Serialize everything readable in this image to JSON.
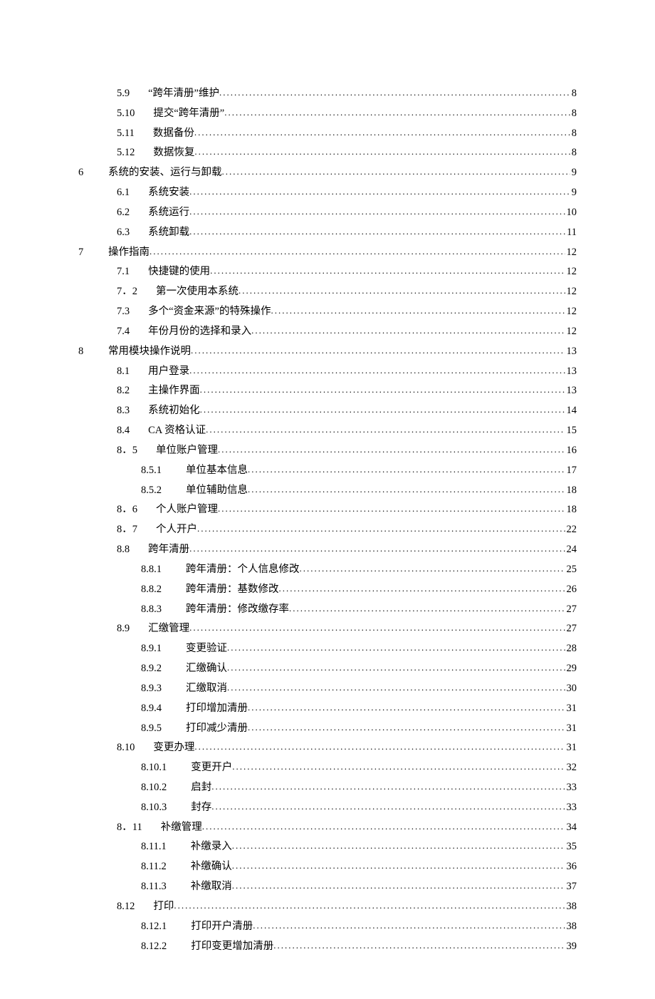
{
  "toc": [
    {
      "level": 1,
      "num": "5.9",
      "title": "“跨年清册”维护",
      "page": "8"
    },
    {
      "level": 1,
      "num": "5.10",
      "title": "提交“跨年清册”",
      "page": "8"
    },
    {
      "level": 1,
      "num": "5.11",
      "title": "数据备份",
      "page": "8"
    },
    {
      "level": 1,
      "num": "5.12",
      "title": "数据恢复",
      "page": "8"
    },
    {
      "level": 0,
      "chap": "6",
      "title": "系统的安装、运行与卸载",
      "page": "9"
    },
    {
      "level": 1,
      "num": "6.1",
      "title": "系统安装",
      "page": "9"
    },
    {
      "level": 1,
      "num": "6.2",
      "title": "系统运行",
      "page": "10"
    },
    {
      "level": 1,
      "num": "6.3",
      "title": "系统卸载",
      "page": "11"
    },
    {
      "level": 0,
      "chap": "7",
      "title": "操作指南",
      "page": "12"
    },
    {
      "level": 1,
      "num": "7.1",
      "title": "快捷键的使用",
      "page": "12"
    },
    {
      "level": 1,
      "num": "7．2",
      "title": "第一次使用本系统",
      "page": "12"
    },
    {
      "level": 1,
      "num": "7.3",
      "title": "多个“资金来源”的特殊操作",
      "page": "12"
    },
    {
      "level": 1,
      "num": "7.4",
      "title": "年份月份的选择和录入",
      "page": "12"
    },
    {
      "level": 0,
      "chap": "8",
      "title": "常用模块操作说明",
      "page": "13"
    },
    {
      "level": 1,
      "num": "8.1",
      "title": "用户登录",
      "page": "13"
    },
    {
      "level": 1,
      "num": "8.2",
      "title": "主操作界面",
      "page": "13"
    },
    {
      "level": 1,
      "num": "8.3",
      "title": "系统初始化",
      "page": "14"
    },
    {
      "level": 1,
      "num": "8.4",
      "title": "CA 资格认证",
      "page": "15"
    },
    {
      "level": 1,
      "num": "8．5",
      "title": "单位账户管理",
      "page": "16"
    },
    {
      "level": 2,
      "num": "8.5.1",
      "title": "单位基本信息",
      "page": "17"
    },
    {
      "level": 2,
      "num": "8.5.2",
      "title": "单位辅助信息",
      "page": "18"
    },
    {
      "level": 1,
      "num": "8．6",
      "title": "个人账户管理",
      "page": "18"
    },
    {
      "level": 1,
      "num": "8．7",
      "title": "个人开户",
      "page": "22"
    },
    {
      "level": 1,
      "num": "8.8",
      "title": "跨年清册",
      "page": "24"
    },
    {
      "level": 2,
      "num": "8.8.1",
      "title": "跨年清册：个人信息修改",
      "page": "25"
    },
    {
      "level": 2,
      "num": "8.8.2",
      "title": "跨年清册：基数修改",
      "page": "26"
    },
    {
      "level": 2,
      "num": "8.8.3",
      "title": "跨年清册：修改缴存率",
      "page": "27"
    },
    {
      "level": 1,
      "num": "8.9",
      "title": "汇缴管理",
      "page": "27"
    },
    {
      "level": 2,
      "num": "8.9.1",
      "title": "变更验证",
      "page": "28"
    },
    {
      "level": 2,
      "num": "8.9.2",
      "title": "汇缴确认",
      "page": "29"
    },
    {
      "level": 2,
      "num": "8.9.3",
      "title": "汇缴取消",
      "page": "30"
    },
    {
      "level": 2,
      "num": "8.9.4",
      "title": "打印增加清册",
      "page": "31"
    },
    {
      "level": 2,
      "num": "8.9.5",
      "title": "打印减少清册",
      "page": "31"
    },
    {
      "level": 1,
      "num": "8.10",
      "title": "变更办理",
      "page": "31"
    },
    {
      "level": 2,
      "num": "8.10.1",
      "title": "变更开户",
      "page": "32"
    },
    {
      "level": 2,
      "num": "8.10.2",
      "title": "启封",
      "page": "33"
    },
    {
      "level": 2,
      "num": "8.10.3",
      "title": "封存",
      "page": "33"
    },
    {
      "level": 1,
      "num": "8．11",
      "title": "补缴管理",
      "page": "34"
    },
    {
      "level": 2,
      "num": "8.11.1",
      "title": "补缴录入",
      "page": "35"
    },
    {
      "level": 2,
      "num": "8.11.2",
      "title": "补缴确认",
      "page": "36"
    },
    {
      "level": 2,
      "num": "8.11.3",
      "title": "补缴取消",
      "page": "37"
    },
    {
      "level": 1,
      "num": "8.12",
      "title": "打印",
      "page": "38"
    },
    {
      "level": 2,
      "num": "8.12.1",
      "title": "打印开户清册",
      "page": "38"
    },
    {
      "level": 2,
      "num": "8.12.2",
      "title": "打印变更增加清册",
      "page": "39"
    }
  ]
}
